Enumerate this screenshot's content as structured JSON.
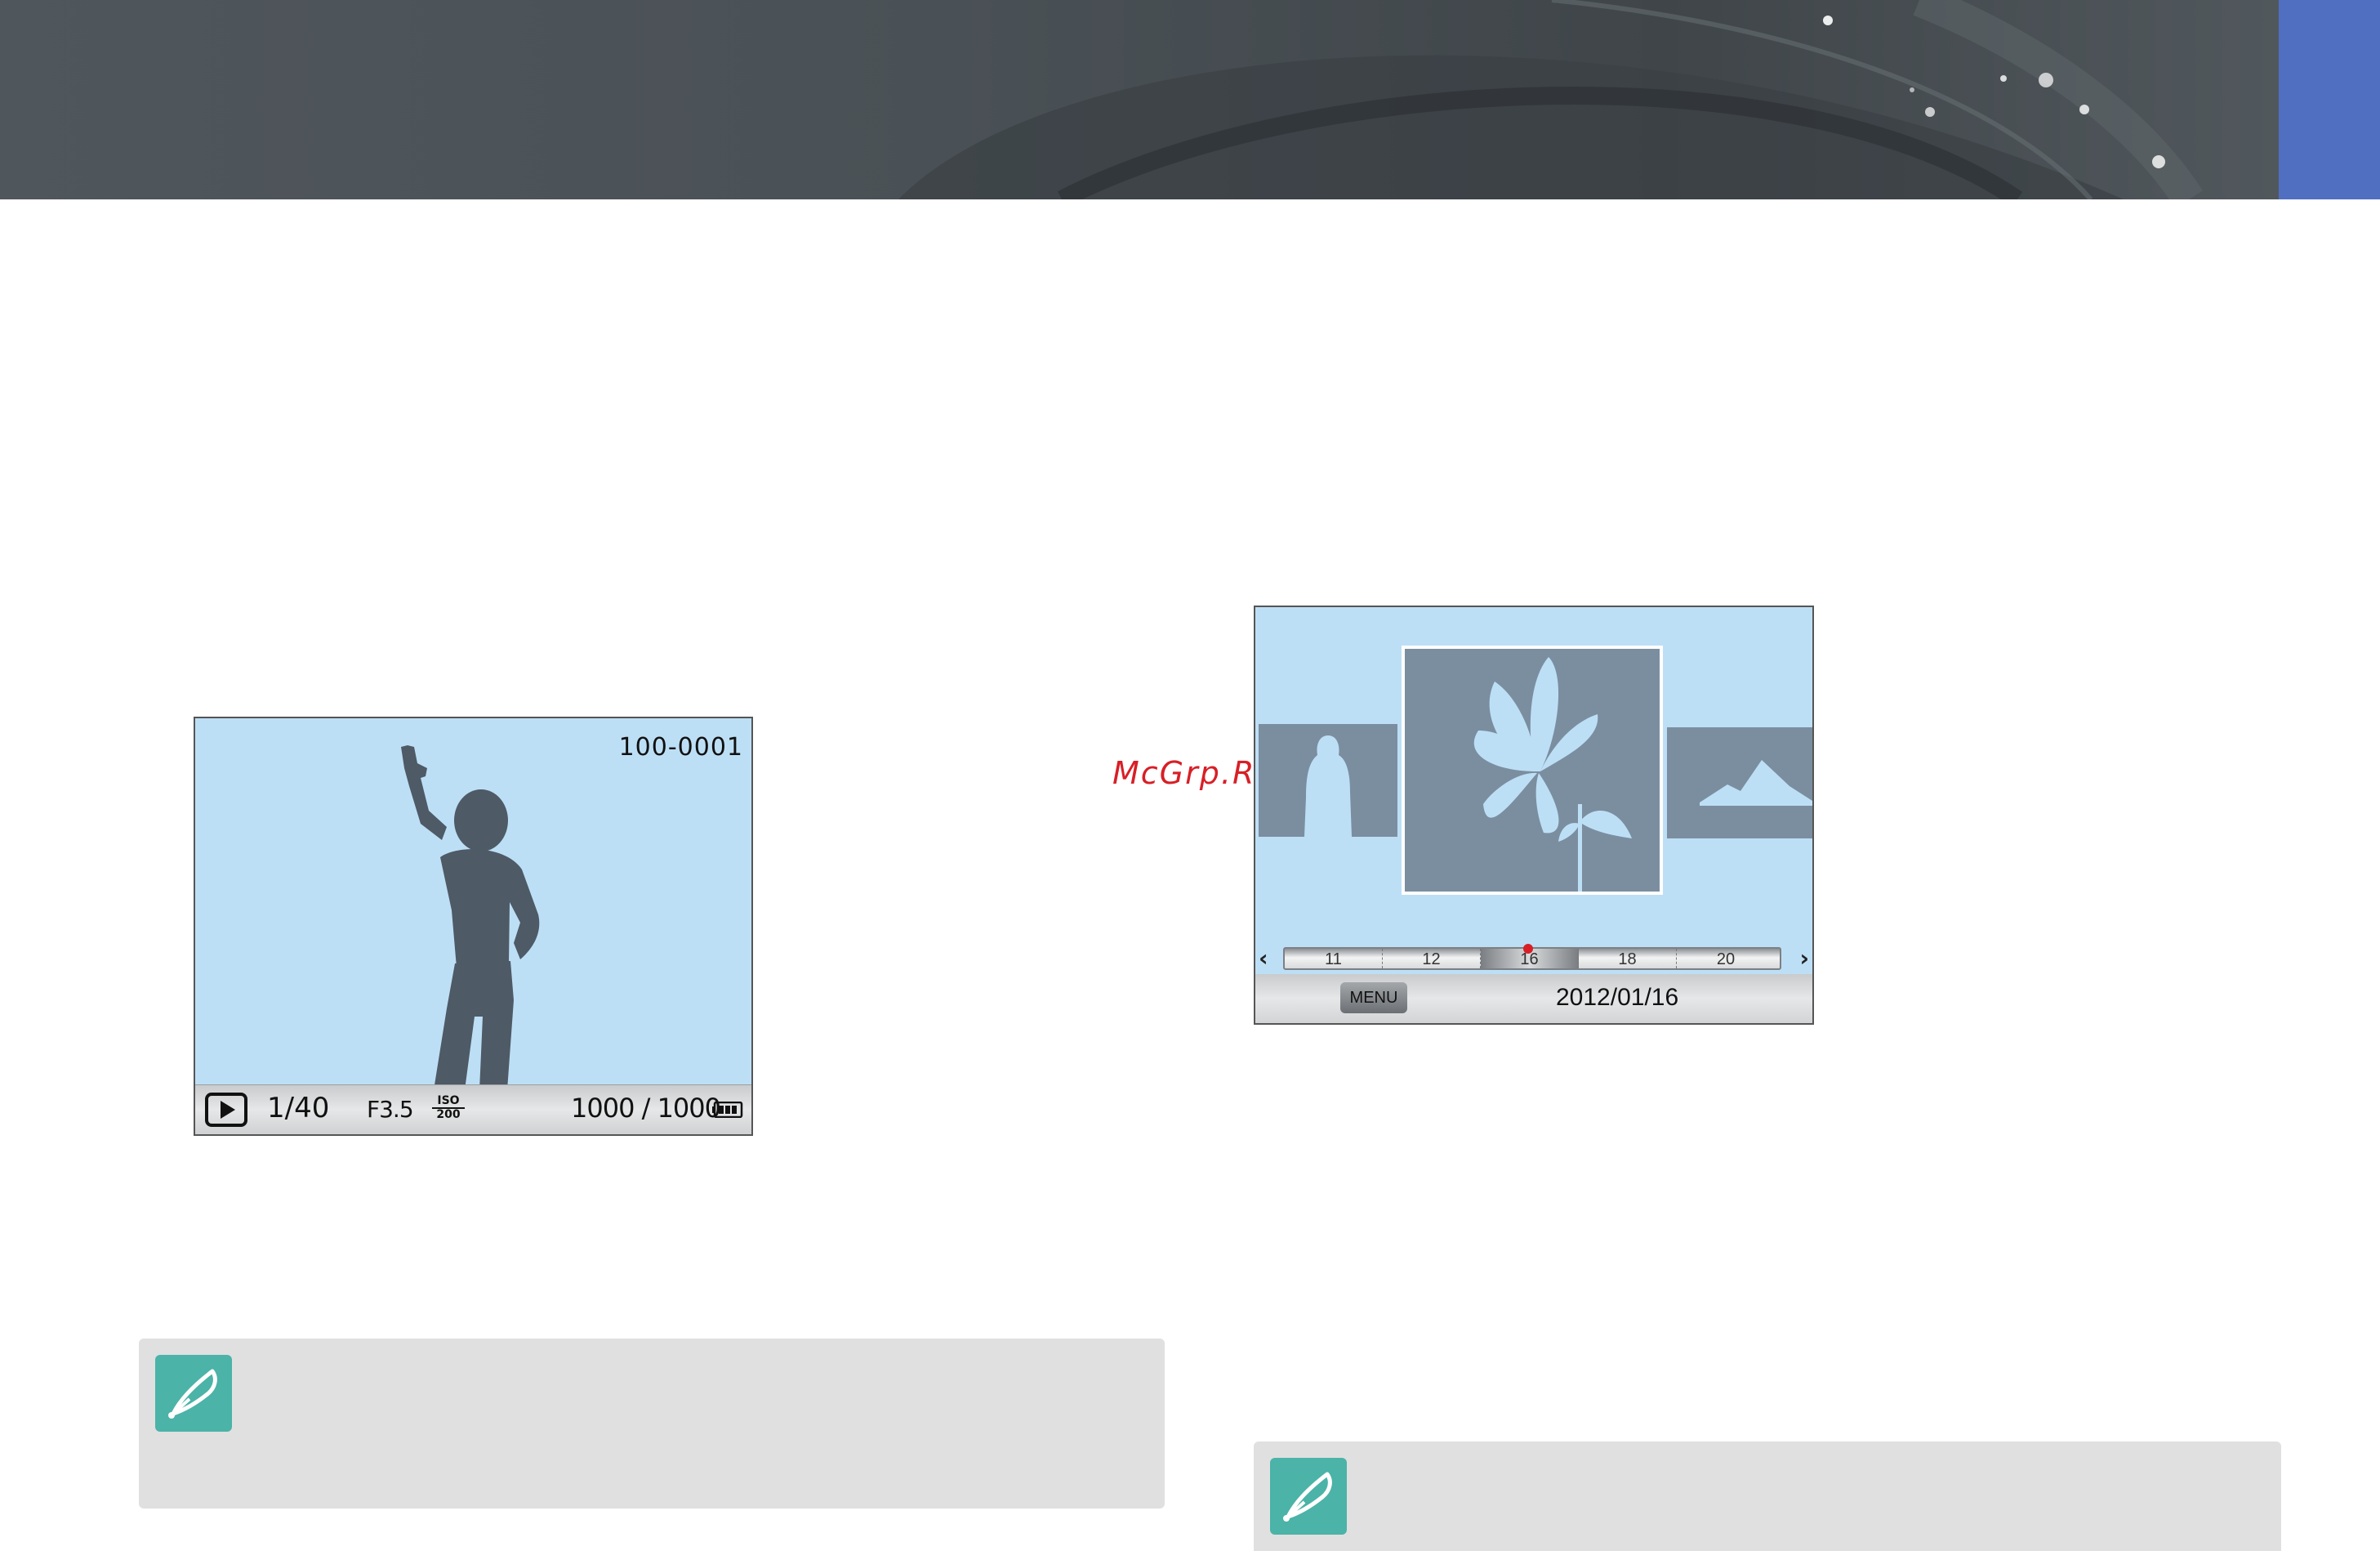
{
  "colors": {
    "header_dark": "#4a5156",
    "header_tab": "#516fc0",
    "screen_background": "#bddff5",
    "silhouette": "#4e5a66",
    "thumbnail": "#7b8ea0",
    "note_background": "#e0e0e1",
    "note_icon": "#4bb3a7",
    "watermark": "#d81f26"
  },
  "header": {
    "icon": "decorative-swirl"
  },
  "watermark": {
    "text": "McGrp.Ru"
  },
  "screen1": {
    "file_number": "100-0001",
    "status_bar": {
      "mode_icon": "play-icon",
      "shutter_speed": "1/40",
      "aperture": "F3.5",
      "iso_label": "ISO",
      "iso_value": "200",
      "shot_count": "1000 / 1000",
      "battery_icon": "battery-full-icon"
    }
  },
  "screen2": {
    "thumbnails": [
      {
        "icon": "person-silhouette-icon"
      },
      {
        "icon": "flower-icon"
      },
      {
        "icon": "mountain-icon"
      }
    ],
    "timeline": {
      "prev_icon": "chevron-left-icon",
      "prev_glyph": "‹",
      "next_icon": "chevron-right-icon",
      "next_glyph": "›",
      "days": [
        "11",
        "12",
        "16",
        "18",
        "20"
      ],
      "selected_day": "16"
    },
    "menu_label": "MENU",
    "date": "2012/01/16"
  },
  "notes": [
    {
      "icon": "note-pen-icon"
    },
    {
      "icon": "note-pen-icon"
    }
  ]
}
